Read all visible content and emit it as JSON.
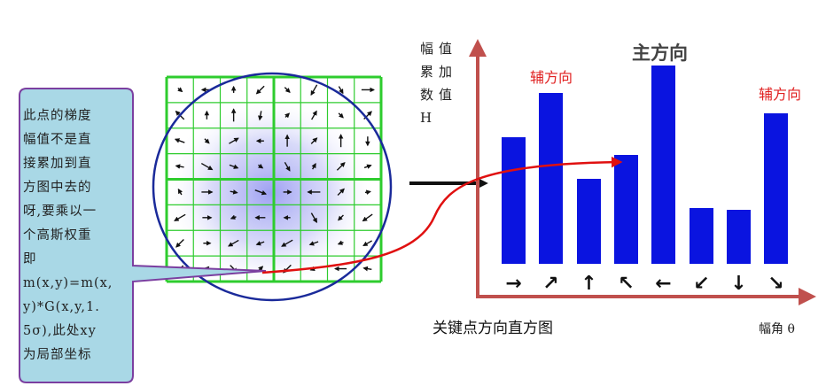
{
  "callout": {
    "lines": [
      "此点的梯度",
      "幅值不是直",
      "接累加到直",
      "方图中去的",
      "呀,要乘以一",
      "个高斯权重",
      "即",
      "m(x,y)=m(x,",
      "y)*G(x,y,1.",
      "5σ),此处xy",
      "为局部坐标"
    ]
  },
  "y_axis_label": {
    "lines": [
      "幅值",
      "累加",
      "数值",
      "H"
    ]
  },
  "x_axis_label": "幅角 θ",
  "main_direction_label": "主方向",
  "aux_direction_left_label": "辅方向",
  "aux_direction_right_label": "辅方向",
  "caption": "关键点方向直方图",
  "colors": {
    "bar": "#0a14e0",
    "axis": "#c0504d",
    "grid": "#2ecc2e",
    "circle": "#1a2a9a",
    "curve": "#e01010",
    "callout_fill": "#a9d8e6",
    "callout_border": "#7b3fa0"
  },
  "chart_data": {
    "type": "bar",
    "categories": [
      "→",
      "↗",
      "↑",
      "↖",
      "←",
      "↙",
      "↓",
      "↘"
    ],
    "values": [
      143,
      193,
      96,
      123,
      224,
      63,
      61,
      170
    ],
    "title": "",
    "xlabel": "幅角 θ",
    "ylabel": "幅值 累加 数值 H"
  }
}
